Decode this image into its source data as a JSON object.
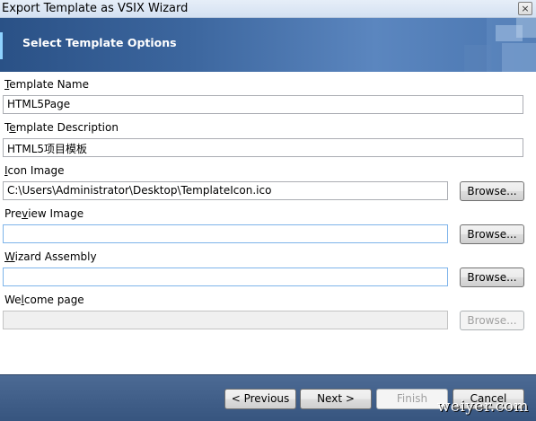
{
  "window": {
    "title": "Export Template as VSIX Wizard",
    "close_glyph": "×"
  },
  "banner": {
    "title": "Select Template Options"
  },
  "form": {
    "template_name": {
      "label_mnemonic": "T",
      "label_rest": "emplate Name",
      "value": "HTML5Page"
    },
    "template_description": {
      "label_pre": "T",
      "label_mnemonic": "e",
      "label_rest": "mplate Description",
      "value": "HTML5项目模板"
    },
    "icon_image": {
      "label_mnemonic": "I",
      "label_rest": "con Image",
      "value": "C:\\Users\\Administrator\\Desktop\\TemplateIcon.ico",
      "browse_pre": "Browse",
      "browse_mnemonic": "",
      "browse_post": "..."
    },
    "preview_image": {
      "label_pre": "Pre",
      "label_mnemonic": "v",
      "label_rest": "iew Image",
      "value": "",
      "browse_label": "Browse..."
    },
    "wizard_assembly": {
      "label_mnemonic": "W",
      "label_rest": "izard Assembly",
      "value": "",
      "browse_label": "Browse..."
    },
    "welcome_page": {
      "label_pre": "We",
      "label_mnemonic": "l",
      "label_rest": "come page",
      "value": "",
      "browse_label": "Browse..."
    }
  },
  "footer": {
    "previous_label": "< Previous",
    "next_label": "Next >",
    "finish_label": "Finish",
    "cancel_label": "Cancel"
  },
  "watermark": "weiyer.com"
}
